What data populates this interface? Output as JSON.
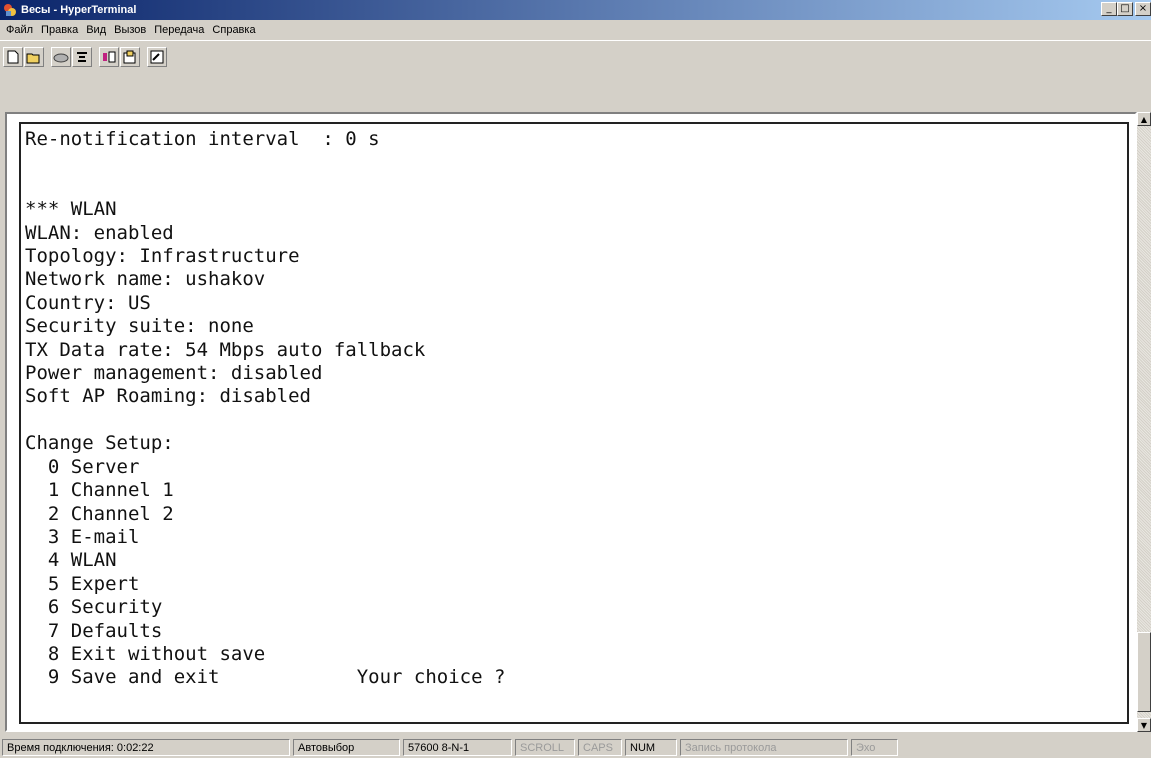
{
  "window": {
    "title": "Весы - HyperTerminal",
    "controls": [
      "_",
      "□",
      "×"
    ]
  },
  "menu": [
    "Файл",
    "Правка",
    "Вид",
    "Вызов",
    "Передача",
    "Справка"
  ],
  "toolbar": {
    "buttons": [
      "new-document-icon",
      "open-folder-icon",
      "phone-icon",
      "disconnect-icon",
      "send-file-icon",
      "receive-file-icon",
      "properties-icon"
    ]
  },
  "terminal": {
    "lines": [
      "Re-notification interval  : 0 s",
      "",
      "",
      "*** WLAN",
      "WLAN: enabled",
      "Topology: Infrastructure",
      "Network name: ushakov",
      "Country: US",
      "Security suite: none",
      "TX Data rate: 54 Mbps auto fallback",
      "Power management: disabled",
      "Soft AP Roaming: disabled",
      "",
      "Change Setup:",
      "  0 Server",
      "  1 Channel 1",
      "  2 Channel 2",
      "  3 E-mail",
      "  4 WLAN",
      "  5 Expert",
      "  6 Security",
      "  7 Defaults",
      "  8 Exit without save",
      "  9 Save and exit            Your choice ?"
    ]
  },
  "status": {
    "connected": "Время подключения: 0:02:22",
    "detect": "Автовыбор",
    "port": "57600 8-N-1",
    "scroll": "SCROLL",
    "caps": "CAPS",
    "num": "NUM",
    "capture": "Запись протокола",
    "echo": "Эхо"
  }
}
